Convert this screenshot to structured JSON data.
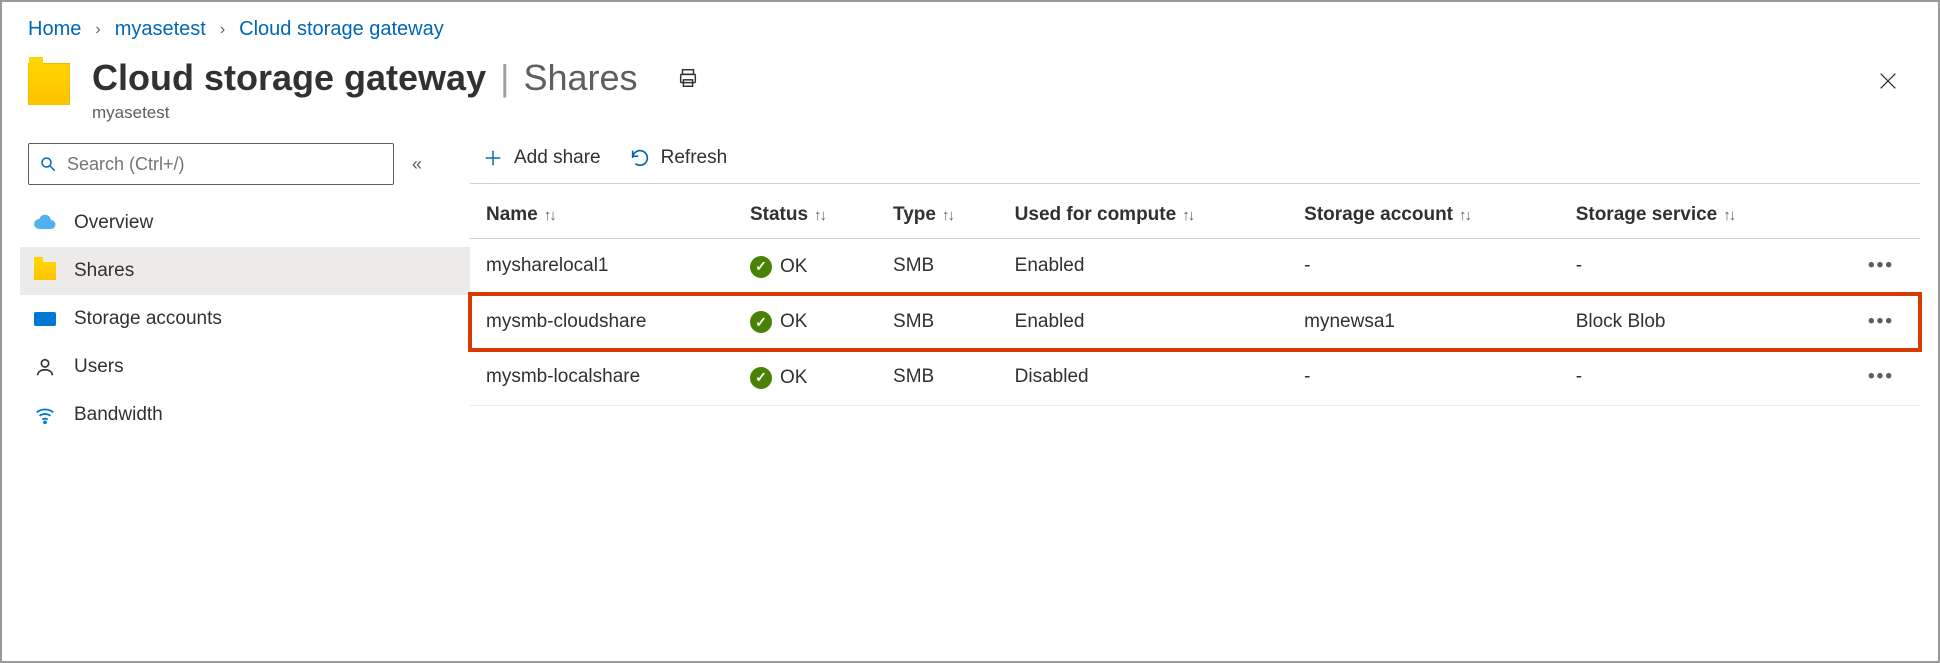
{
  "breadcrumb": {
    "items": [
      "Home",
      "myasetest",
      "Cloud storage gateway"
    ]
  },
  "header": {
    "title": "Cloud storage gateway",
    "section": "Shares",
    "subtitle": "myasetest"
  },
  "search": {
    "placeholder": "Search (Ctrl+/)"
  },
  "sidebar": {
    "items": [
      {
        "label": "Overview",
        "icon": "cloud"
      },
      {
        "label": "Shares",
        "icon": "folder",
        "active": true
      },
      {
        "label": "Storage accounts",
        "icon": "storage"
      },
      {
        "label": "Users",
        "icon": "user"
      },
      {
        "label": "Bandwidth",
        "icon": "wifi"
      }
    ]
  },
  "commands": {
    "add": "Add share",
    "refresh": "Refresh"
  },
  "table": {
    "columns": {
      "name": "Name",
      "status": "Status",
      "type": "Type",
      "used": "Used for compute",
      "account": "Storage account",
      "service": "Storage service"
    },
    "rows": [
      {
        "name": "mysharelocal1",
        "status": "OK",
        "type": "SMB",
        "used": "Enabled",
        "account": "-",
        "service": "-",
        "highlight": false
      },
      {
        "name": "mysmb-cloudshare",
        "status": "OK",
        "type": "SMB",
        "used": "Enabled",
        "account": "mynewsa1",
        "service": "Block Blob",
        "highlight": true
      },
      {
        "name": "mysmb-localshare",
        "status": "OK",
        "type": "SMB",
        "used": "Disabled",
        "account": "-",
        "service": "-",
        "highlight": false
      }
    ]
  }
}
